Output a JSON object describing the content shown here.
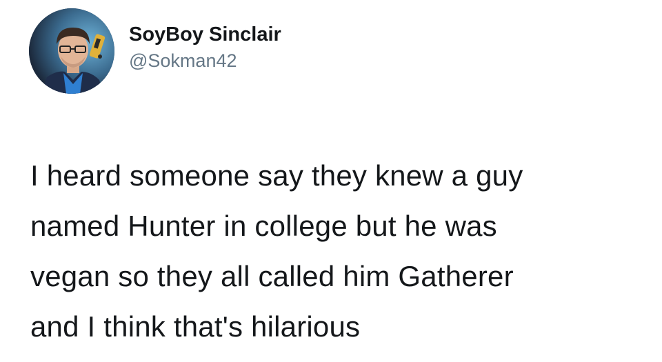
{
  "author": {
    "display_name": "SoyBoy Sinclair",
    "handle": "@Sokman42",
    "avatar_icon": "profile-photo"
  },
  "tweet": {
    "lines": [
      "I heard someone say they knew a guy",
      "named Hunter in college but he was",
      "vegan so they all called him Gatherer",
      "and I think that's hilarious"
    ]
  },
  "colors": {
    "background": "#ffffff",
    "text": "#14171a",
    "handle": "#657786"
  }
}
